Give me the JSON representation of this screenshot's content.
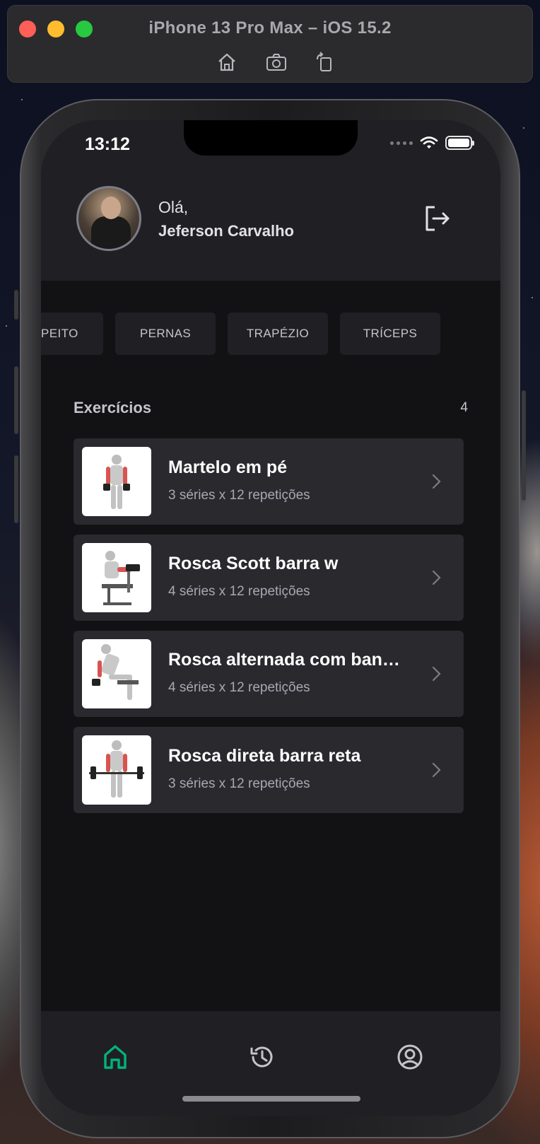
{
  "simulator": {
    "title": "iPhone 13 Pro Max – iOS 15.2",
    "toolbar": [
      "home-icon",
      "screenshot-icon",
      "rotate-icon"
    ]
  },
  "status_bar": {
    "time": "13:12"
  },
  "header": {
    "greeting": "Olá,",
    "user_name": "Jeferson Carvalho"
  },
  "groups": [
    {
      "label": "PEITO"
    },
    {
      "label": "PERNAS"
    },
    {
      "label": "TRAPÉZIO"
    },
    {
      "label": "TRÍCEPS"
    }
  ],
  "exercises": {
    "heading": "Exercícios",
    "count": "4",
    "items": [
      {
        "name": "Martelo em pé",
        "detail": "3 séries x 12 repetições"
      },
      {
        "name": "Rosca Scott barra w",
        "detail": "4 séries x 12 repetições"
      },
      {
        "name": "Rosca alternada com banco inclinado",
        "detail": "4 séries x 12 repetições"
      },
      {
        "name": "Rosca direta barra reta",
        "detail": "3 séries x 12 repetições"
      }
    ]
  },
  "tabs": [
    {
      "name": "home",
      "active": true
    },
    {
      "name": "history",
      "active": false
    },
    {
      "name": "profile",
      "active": false
    }
  ],
  "colors": {
    "accent": "#00B37E",
    "card": "#29292E",
    "background": "#121214",
    "header": "#202024"
  }
}
